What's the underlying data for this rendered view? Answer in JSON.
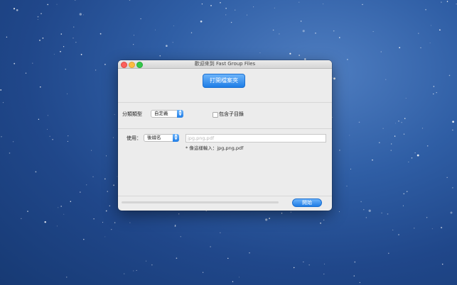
{
  "window": {
    "title": "歡迎來到 Fast Group Files"
  },
  "actions": {
    "open_folder_label": "打開檔案夾",
    "start_label": "開始"
  },
  "classification": {
    "label": "分類類型",
    "selected_type": "自定義",
    "include_subdirs_label": "包含子目錄",
    "include_subdirs_checked": false
  },
  "usage": {
    "label": "使用：",
    "selected_criterion": "後綴名",
    "extensions_placeholder": "jpg,png,pdf",
    "extensions_value": "",
    "hint": "* 像這樣輸入：jpg,png,pdf"
  },
  "progress": {
    "value": 0
  },
  "colors": {
    "accent": "#1e7de6",
    "window_bg": "#ececec"
  }
}
